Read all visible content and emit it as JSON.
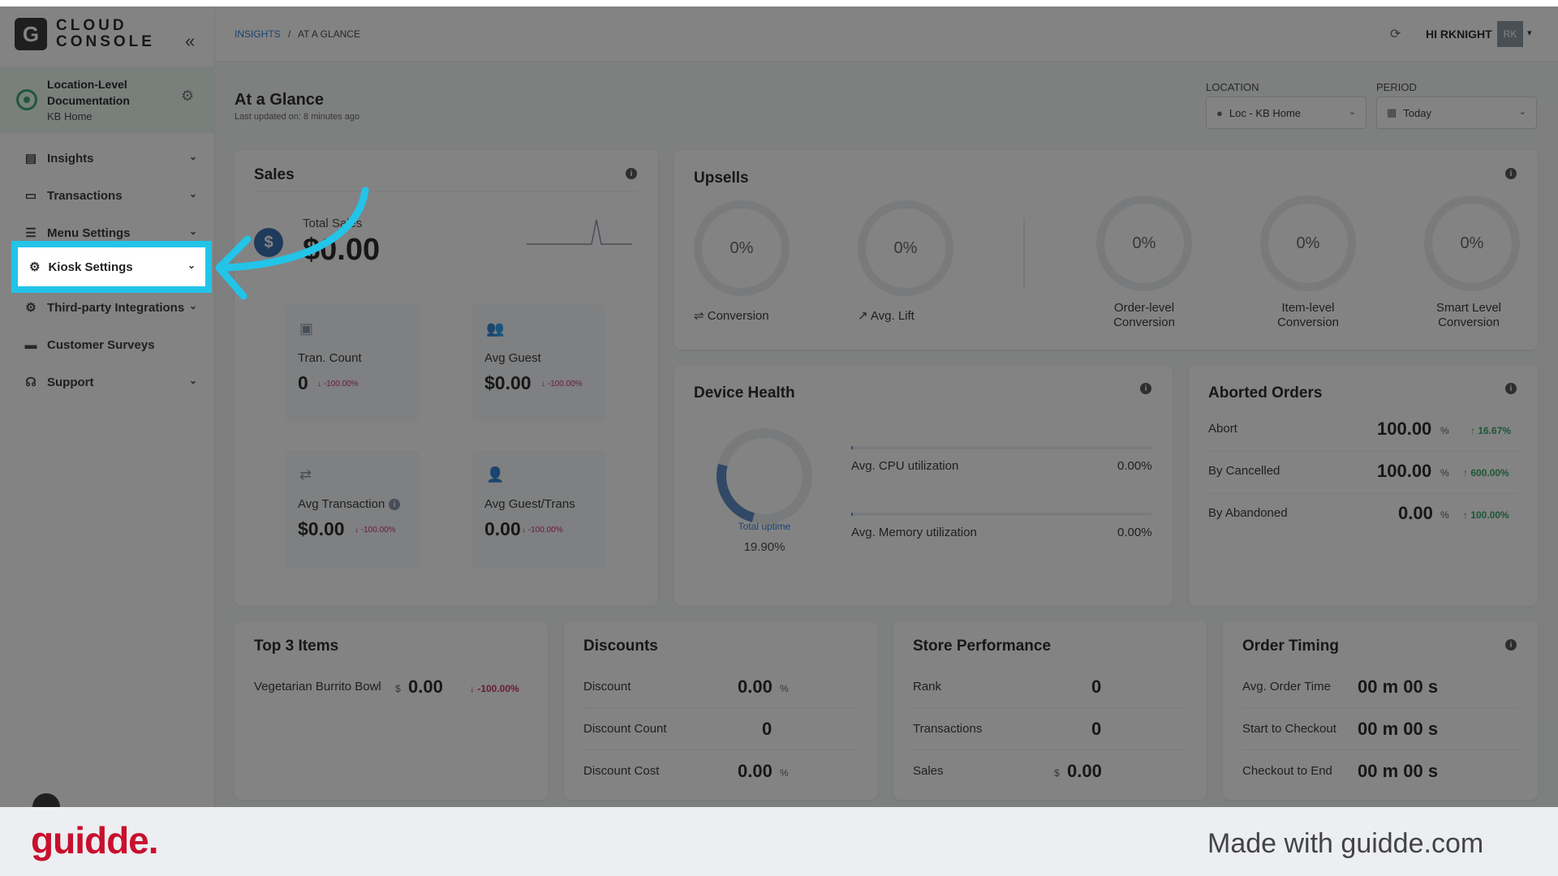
{
  "app": {
    "logo_letter": "G",
    "logo_line1": "CLOUD",
    "logo_line2": "CONSOLE"
  },
  "location_block": {
    "title": "Location-Level Documentation",
    "subtitle": "KB Home"
  },
  "sidebar": {
    "items": [
      {
        "label": "Insights",
        "icon": "chart-icon",
        "has_chevron": true
      },
      {
        "label": "Transactions",
        "icon": "receipt-icon",
        "has_chevron": true
      },
      {
        "label": "Menu Settings",
        "icon": "menu-icon",
        "has_chevron": true
      },
      {
        "label": "Kiosk Settings",
        "icon": "gear-icon",
        "has_chevron": true
      },
      {
        "label": "Third-party Integrations",
        "icon": "integration-icon",
        "has_chevron": true
      },
      {
        "label": "Customer Surveys",
        "icon": "briefcase-icon",
        "has_chevron": false
      },
      {
        "label": "Support",
        "icon": "headset-icon",
        "has_chevron": true
      }
    ]
  },
  "header": {
    "breadcrumb_root": "INSIGHTS",
    "breadcrumb_sep": "/",
    "breadcrumb_current": "AT A GLANCE",
    "user_greeting": "HI RKNIGHT",
    "avatar_initials": "RK"
  },
  "page": {
    "title": "At a Glance",
    "subtitle": "Last updated on: 8 minutes ago",
    "location_label": "LOCATION",
    "location_value": "Loc - KB Home",
    "period_label": "PERIOD",
    "period_value": "Today"
  },
  "sales": {
    "title": "Sales",
    "total_label": "Total Sales",
    "total_value": "$0.00",
    "metrics": [
      {
        "label": "Tran. Count",
        "value": "0",
        "delta": "↓ -100.00%"
      },
      {
        "label": "Avg Guest",
        "value": "$0.00",
        "delta": "↓ -100.00%"
      },
      {
        "label": "Avg Transaction",
        "value": "$0.00",
        "delta": "↓ -100.00%"
      },
      {
        "label": "Avg Guest/Trans",
        "value": "0.00",
        "delta": "↓ -100.00%"
      }
    ]
  },
  "upsells": {
    "title": "Upsells",
    "items": [
      {
        "value": "0%",
        "label": "Conversion"
      },
      {
        "value": "0%",
        "label": "Avg. Lift"
      },
      {
        "value": "0%",
        "label_line1": "Order-level",
        "label_line2": "Conversion"
      },
      {
        "value": "0%",
        "label_line1": "Item-level",
        "label_line2": "Conversion"
      },
      {
        "value": "0%",
        "label_line1": "Smart Level",
        "label_line2": "Conversion"
      }
    ]
  },
  "device_health": {
    "title": "Device Health",
    "uptime_label": "Total uptime",
    "uptime_value": "19.90%",
    "uptime_fraction": 0.199,
    "cpu_label": "Avg. CPU utilization",
    "cpu_value": "0.00%",
    "mem_label": "Avg. Memory utilization",
    "mem_value": "0.00%"
  },
  "aborted": {
    "title": "Aborted Orders",
    "rows": [
      {
        "label": "Abort",
        "value": "100.00",
        "unit": "%",
        "delta": "↑ 16.67%"
      },
      {
        "label": "By Cancelled",
        "value": "100.00",
        "unit": "%",
        "delta": "↑ 600.00%"
      },
      {
        "label": "By Abandoned",
        "value": "0.00",
        "unit": "%",
        "delta": "↑ 100.00%"
      }
    ]
  },
  "top_items": {
    "title": "Top 3 Items",
    "rows": [
      {
        "label": "Vegetarian Burrito Bowl",
        "currency": "$",
        "value": "0.00",
        "delta": "↓ -100.00%"
      }
    ]
  },
  "discounts": {
    "title": "Discounts",
    "rows": [
      {
        "label": "Discount",
        "value": "0.00",
        "unit": "%"
      },
      {
        "label": "Discount Count",
        "value": "0",
        "unit": ""
      },
      {
        "label": "Discount Cost",
        "value": "0.00",
        "unit": "%"
      }
    ]
  },
  "store_performance": {
    "title": "Store Performance",
    "rows": [
      {
        "label": "Rank",
        "value": "0",
        "currency": ""
      },
      {
        "label": "Transactions",
        "value": "0",
        "currency": ""
      },
      {
        "label": "Sales",
        "value": "0.00",
        "currency": "$"
      }
    ]
  },
  "order_timing": {
    "title": "Order Timing",
    "rows": [
      {
        "label": "Avg. Order Time",
        "value": "00 m 00 s"
      },
      {
        "label": "Start to Checkout",
        "value": "00 m 00 s"
      },
      {
        "label": "Checkout to End",
        "value": "00 m 00 s"
      }
    ]
  },
  "footer": {
    "brand": "guidde.",
    "tagline": "Made with guidde.com"
  },
  "colors": {
    "highlight": "#22c4e8",
    "brand_red": "#c8102e",
    "delta_down": "#c2185b",
    "delta_up": "#1f9d55"
  }
}
